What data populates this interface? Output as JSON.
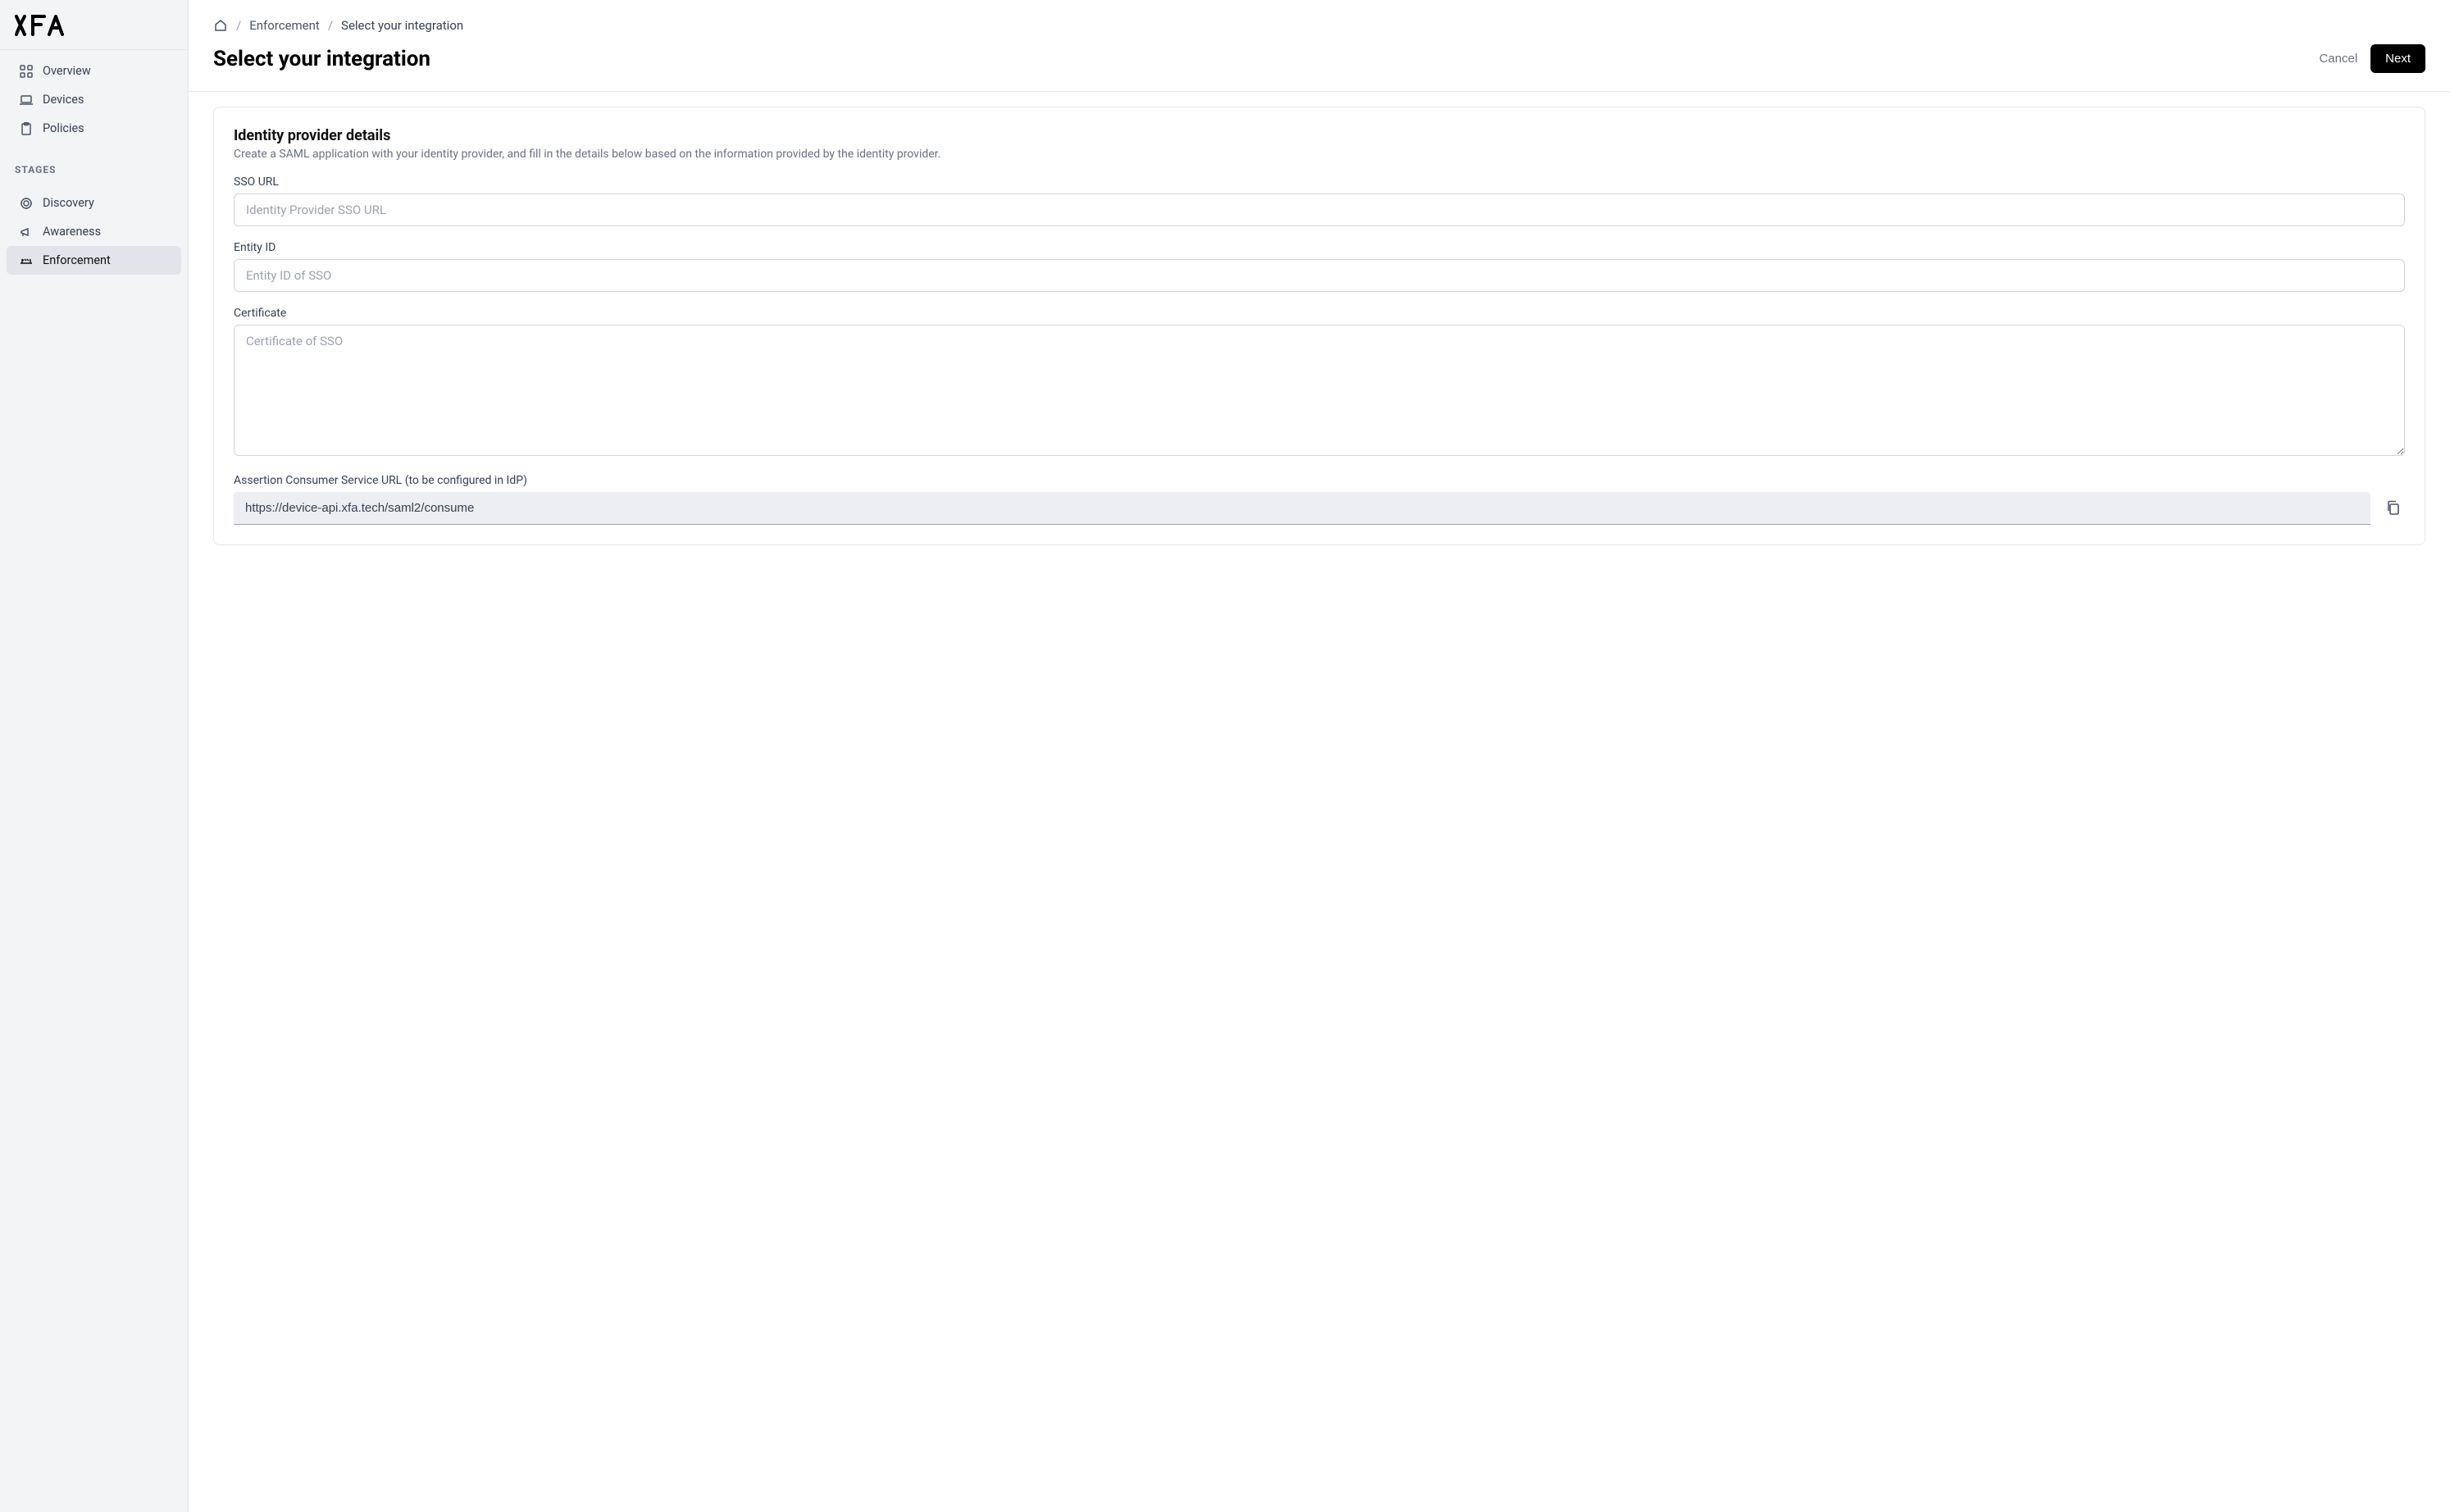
{
  "brand": {
    "name": "XFA"
  },
  "sidebar": {
    "nav": [
      {
        "label": "Overview",
        "icon": "grid-icon"
      },
      {
        "label": "Devices",
        "icon": "laptop-icon"
      },
      {
        "label": "Policies",
        "icon": "clipboard-icon"
      }
    ],
    "stages_heading": "STAGES",
    "stages": [
      {
        "label": "Discovery",
        "icon": "target-icon"
      },
      {
        "label": "Awareness",
        "icon": "megaphone-icon"
      },
      {
        "label": "Enforcement",
        "icon": "barrier-icon",
        "active": true
      }
    ]
  },
  "breadcrumb": {
    "home_icon": "home-icon",
    "items": [
      "Enforcement",
      "Select your integration"
    ]
  },
  "page": {
    "title": "Select your integration",
    "cancel_label": "Cancel",
    "next_label": "Next"
  },
  "form": {
    "heading": "Identity provider details",
    "subheading": "Create a SAML application with your identity provider, and fill in the details below based on the information provided by the identity provider.",
    "fields": {
      "sso_url": {
        "label": "SSO URL",
        "placeholder": "Identity Provider SSO URL",
        "value": ""
      },
      "entity_id": {
        "label": "Entity ID",
        "placeholder": "Entity ID of SSO",
        "value": ""
      },
      "certificate": {
        "label": "Certificate",
        "placeholder": "Certificate of SSO",
        "value": ""
      },
      "acs_url": {
        "label": "Assertion Consumer Service URL (to be configured in IdP)",
        "value": "https://device-api.xfa.tech/saml2/consume"
      }
    }
  }
}
